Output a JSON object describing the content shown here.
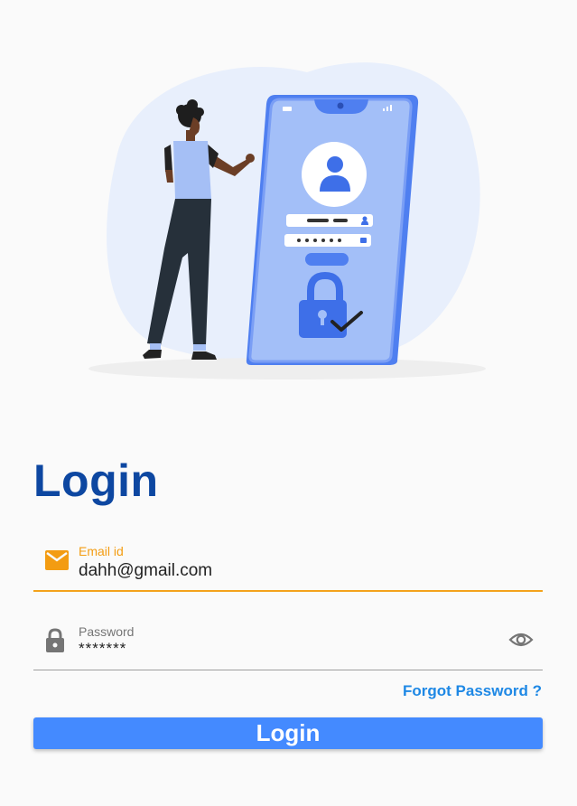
{
  "login_title": "Login",
  "email": {
    "label": "Email id",
    "value": "dahh@gmail.com",
    "icon": "envelope-icon"
  },
  "password": {
    "label": "Password",
    "value": "*******",
    "icon": "lock-icon",
    "toggle_icon": "eye-icon"
  },
  "forgot_label": "Forgot Password ?",
  "login_button_label": "Login",
  "colors": {
    "title": "#0d47a1",
    "accent_focus": "#f4a21c",
    "link": "#1e88e5",
    "button": "#448aff"
  }
}
